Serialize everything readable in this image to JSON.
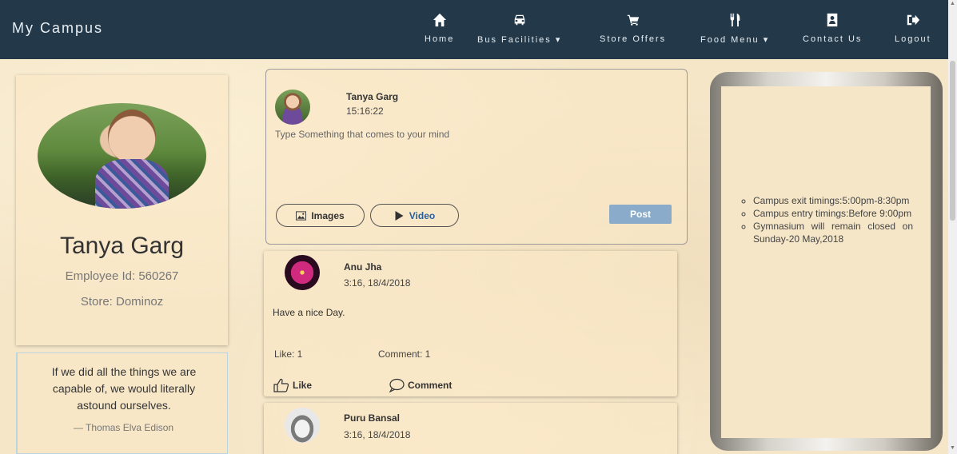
{
  "navbar": {
    "brand": "My Campus",
    "items": [
      {
        "label": "Home",
        "icon": "home-icon"
      },
      {
        "label": "Bus Facilities ▾",
        "icon": "bus-icon"
      },
      {
        "label": "Store Offers",
        "icon": "cart-icon"
      },
      {
        "label": "Food Menu ▾",
        "icon": "cutlery-icon"
      },
      {
        "label": "Contact Us",
        "icon": "contact-icon"
      },
      {
        "label": "Logout",
        "icon": "logout-icon"
      }
    ]
  },
  "profile": {
    "name": "Tanya Garg",
    "employee_id": "Employee Id: 560267",
    "store": "Store: Dominoz"
  },
  "quote": {
    "text": "If we did all the things we are capable of, we would literally astound ourselves.",
    "author": "— Thomas Elva Edison"
  },
  "composer": {
    "author": "Tanya Garg",
    "time": "15:16:22",
    "placeholder": "Type Something that comes to your mind",
    "images_label": "Images",
    "video_label": "Video",
    "post_label": "Post"
  },
  "posts": [
    {
      "author": "Anu Jha",
      "time": "3:16, 18/4/2018",
      "body": "Have a nice Day.",
      "likes": "Like: 1",
      "comments": "Comment: 1",
      "like_label": "Like",
      "comment_label": "Comment"
    },
    {
      "author": "Puru Bansal",
      "time": "3:16, 18/4/2018"
    }
  ],
  "notices": [
    "Campus exit timings:5:00pm-8:30pm",
    "Campus entry timings:Before 9:00pm",
    "Gymnasium will remain closed on Sunday-20 May,2018"
  ],
  "colors": {
    "navbar": "#23394a",
    "background": "#f5e6c8",
    "post_button": "#8aabc9"
  }
}
